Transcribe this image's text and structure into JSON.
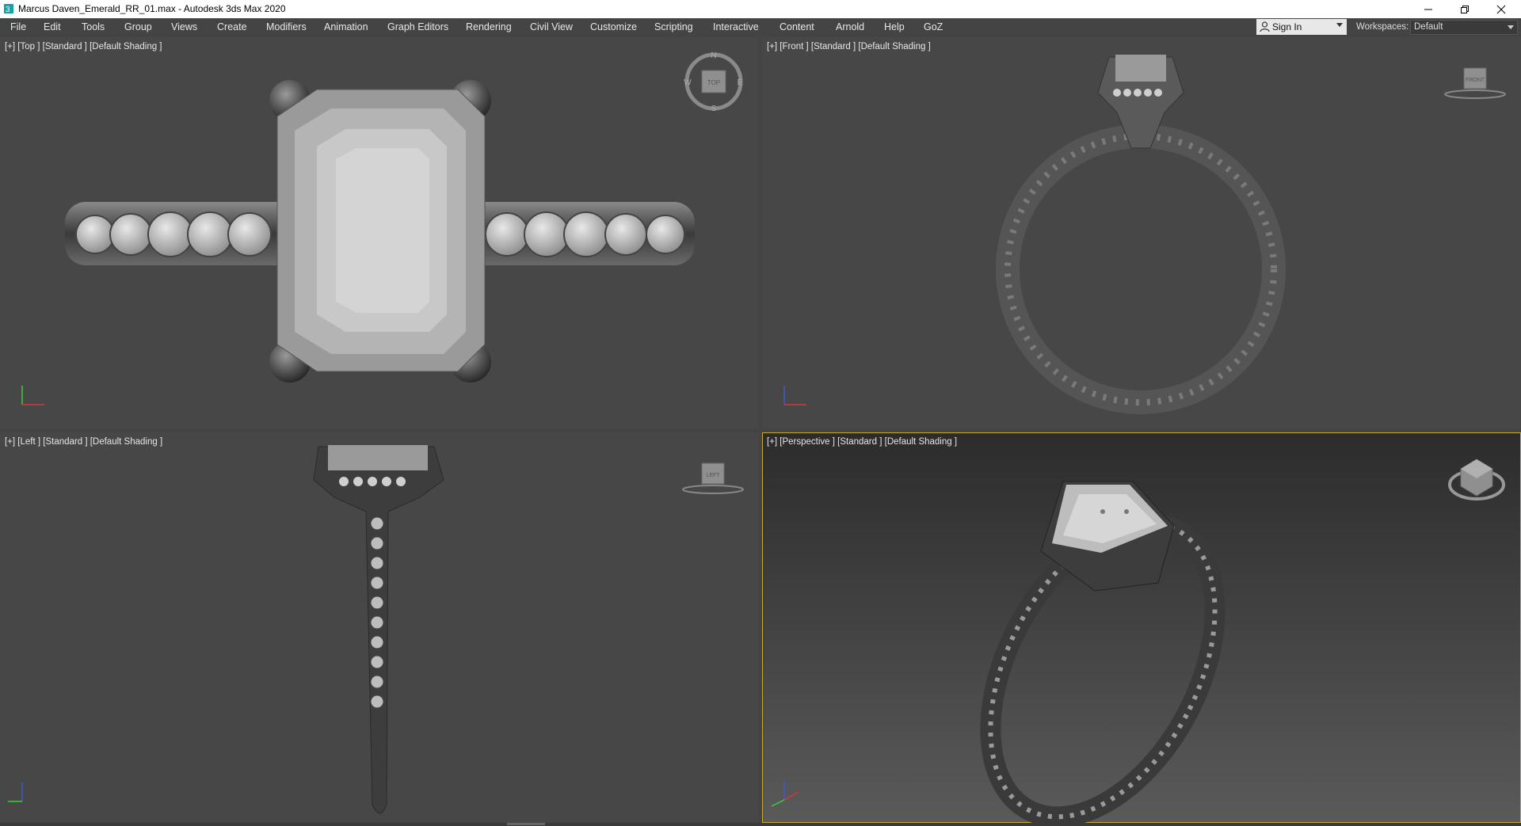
{
  "window": {
    "title": "Marcus Daven_Emerald_RR_01.max - Autodesk 3ds Max 2020",
    "controls": [
      "minimize-icon",
      "restore-icon",
      "close-icon"
    ]
  },
  "menu": {
    "items": [
      "File",
      "Edit",
      "Tools",
      "Group",
      "Views",
      "Create",
      "Modifiers",
      "Animation",
      "Graph Editors",
      "Rendering",
      "Civil View",
      "Customize",
      "Scripting",
      "Interactive",
      "Content",
      "Arnold",
      "Help",
      "GoZ"
    ],
    "sign_in": "Sign In",
    "workspaces_label": "Workspaces:",
    "workspace_value": "Default"
  },
  "viewports": {
    "top": {
      "label": "[+] [Top ] [Standard ] [Default Shading ]",
      "cube": "TOP",
      "compass": [
        "N",
        "E",
        "S",
        "W"
      ]
    },
    "front": {
      "label": "[+] [Front ] [Standard ] [Default Shading ]",
      "cube": "FRONT"
    },
    "left": {
      "label": "[+] [Left ] [Standard ] [Default Shading ]",
      "cube": "LEFT"
    },
    "perspective": {
      "label": "[+] [Perspective ] [Standard ] [Default Shading ]"
    }
  },
  "colors": {
    "viewport_bg": "#474747",
    "active_border": "#c9a83a",
    "axis_x": "#d23a3a",
    "axis_y": "#3acf3a",
    "axis_z": "#3a5ad2"
  }
}
